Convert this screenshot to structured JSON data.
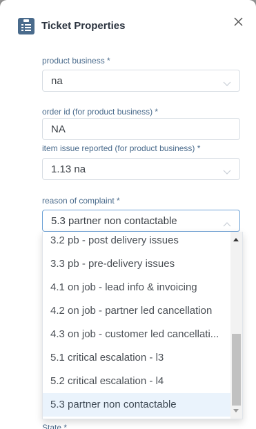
{
  "header": {
    "title": "Ticket Properties",
    "icon": "clipboard-list-icon",
    "close_icon": "close-icon"
  },
  "fields": [
    {
      "label": "product business *",
      "value": "na",
      "type": "select"
    },
    {
      "label": "order id (for product business) *",
      "value": "NA",
      "type": "text"
    },
    {
      "label": "item issue reported (for product business) *",
      "value": "1.13 na",
      "type": "select"
    },
    {
      "label": "reason of complaint *",
      "value": "5.3 partner non contactable",
      "type": "select",
      "open": true
    }
  ],
  "dropdown": {
    "options": [
      "3.2 pb - post delivery issues",
      "3.3 pb - pre-delivery issues",
      "4.1 on job - lead info & invoicing",
      "4.2 on job - partner led cancellation",
      "4.3 on job - customer led cancellati...",
      "5.1 critical escalation - l3",
      "5.2 critical escalation - l4",
      "5.3 partner non contactable"
    ],
    "selected": "5.3 partner non contactable"
  },
  "state_label": "State *",
  "colors": {
    "label": "#4a6b8c",
    "accent_border": "#6fa3d6",
    "selected_bg": "#eaf3fc"
  }
}
